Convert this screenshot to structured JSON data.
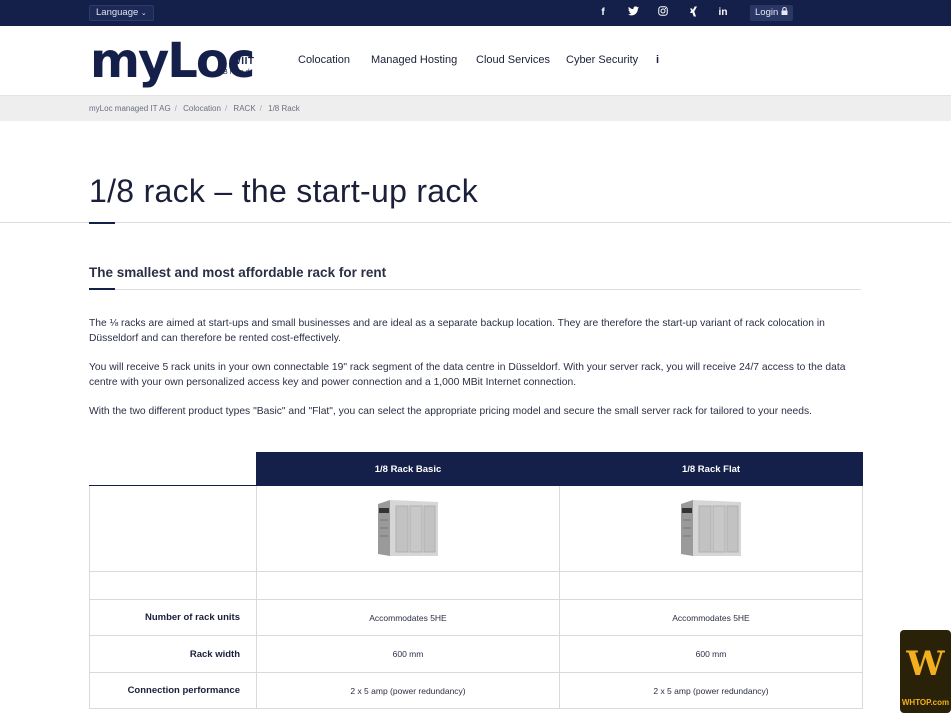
{
  "topbar": {
    "language_label": "Language",
    "login_label": "Login",
    "social_icons": [
      "facebook-icon",
      "twitter-icon",
      "instagram-icon",
      "xing-icon",
      "linkedin-icon"
    ]
  },
  "header": {
    "logo_word": "myLoc",
    "logo_tag_a": "a",
    "logo_tag_brand_name": "WIIT",
    "logo_tag_brand": "Brand",
    "nav": [
      "Colocation",
      "Managed Hosting",
      "Cloud Services",
      "Cyber Security"
    ],
    "info_label": "i"
  },
  "breadcrumb": [
    "myLoc managed IT AG",
    "Colocation",
    "RACK",
    "1/8 Rack"
  ],
  "page": {
    "title": "1/8 rack – the start-up rack",
    "subtitle": "The smallest and most affordable rack for rent",
    "paragraphs": [
      "The ⅛ racks are aimed at start-ups and small businesses and are ideal as a separate backup location. They are therefore the start-up variant of rack colocation in Düsseldorf and can therefore be rented cost-effectively.",
      "You will receive 5 rack units in your own connectable 19\" rack segment of the data centre in Düsseldorf. With your server rack, you will receive 24/7 access to the data centre with your own personalized access key and power connection and a 1,000 MBit Internet connection.",
      "With the two different product types \"Basic\" and \"Flat\", you can select the appropriate pricing model and secure the small server rack for tailored to your needs."
    ]
  },
  "table": {
    "columns": [
      "1/8 Rack Basic",
      "1/8 Rack Flat"
    ],
    "rows": [
      {
        "label": "Number of rack units",
        "values": [
          "Accommodates 5HE",
          "Accommodates 5HE"
        ]
      },
      {
        "label": "Rack width",
        "values": [
          "600 mm",
          "600 mm"
        ]
      },
      {
        "label": "Connection performance",
        "values": [
          "2 x 5 amp (power redundancy)",
          "2 x 5 amp (power redundancy)"
        ]
      }
    ]
  },
  "badge": {
    "mark": "W",
    "text": "WHTOP.com"
  },
  "colors": {
    "navy": "#14204a",
    "badge_gold": "#f2b021"
  }
}
